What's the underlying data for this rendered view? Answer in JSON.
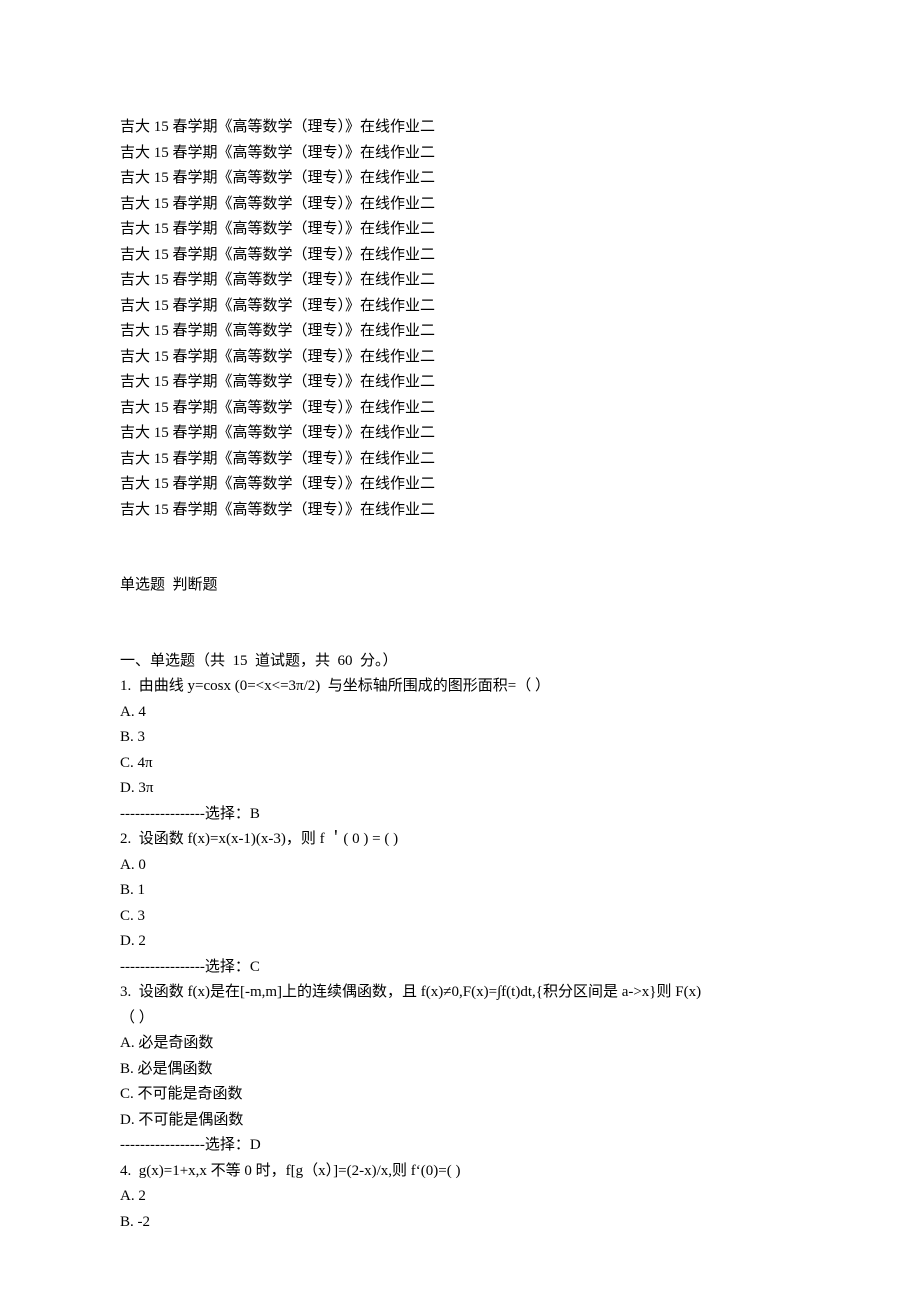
{
  "repeated_title": "吉大 15 春学期《高等数学（理专）》在线作业二",
  "repeat_count": 16,
  "section_types": "单选题  判断题",
  "section1_header": "一、单选题（共  15  道试题，共  60  分。）",
  "questions": [
    {
      "num": "1.",
      "stem": "  由曲线 y=cosx (0=<x<=3π/2)  与坐标轴所围成的图形面积=（ ）",
      "options": [
        "A. 4",
        "B. 3",
        "C. 4π",
        "D. 3π"
      ],
      "answer": "-----------------选择：B"
    },
    {
      "num": "2.",
      "stem": "  设函数 f(x)=x(x-1)(x-3)，则 f ＇( 0 ) = ( )",
      "options": [
        "A. 0",
        "B. 1",
        "C. 3",
        "D. 2"
      ],
      "answer": "-----------------选择：C"
    },
    {
      "num": "3.",
      "stem": "  设函数 f(x)是在[-m,m]上的连续偶函数，且 f(x)≠0,F(x)=∫f(t)dt,{积分区间是 a->x}则 F(x)",
      "stem2": "（ ）",
      "options": [
        "A. 必是奇函数",
        "B. 必是偶函数",
        "C. 不可能是奇函数",
        "D. 不可能是偶函数"
      ],
      "answer": "-----------------选择：D"
    },
    {
      "num": "4.",
      "stem": "  g(x)=1+x,x 不等 0 时，f[g（x）]=(2-x)/x,则 f‘(0)=( )",
      "options": [
        "A. 2",
        "B. -2"
      ],
      "answer": ""
    }
  ]
}
